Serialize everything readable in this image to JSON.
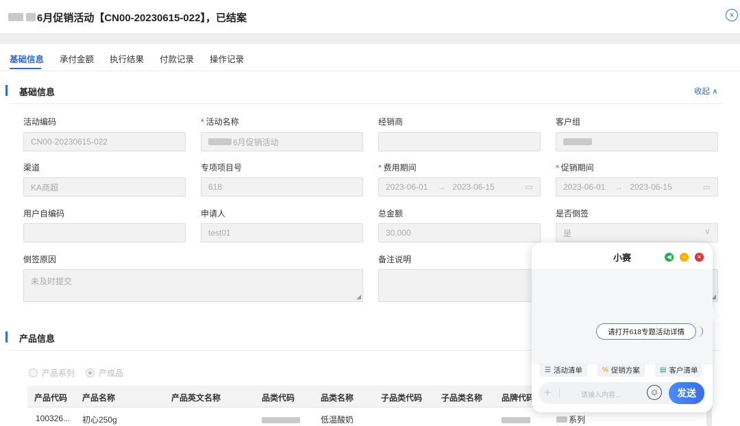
{
  "header": {
    "title": "6月促销活动【CN00-20230615-022】，已结案"
  },
  "tabs": [
    "基础信息",
    "承付金额",
    "执行结果",
    "付款记录",
    "操作记录"
  ],
  "sections": {
    "basic": {
      "title": "基础信息",
      "collapse": "收起 ∧"
    },
    "product": {
      "title": "产品信息"
    }
  },
  "fields": {
    "activity_code": {
      "label": "活动编码",
      "value": "CN00-20230615-022"
    },
    "activity_name": {
      "label": "活动名称",
      "value": "6月促销活动"
    },
    "dealer": {
      "label": "经销商",
      "value": ""
    },
    "customer_group": {
      "label": "客户组",
      "value": ""
    },
    "channel": {
      "label": "渠道",
      "value": "KA商超"
    },
    "project_no": {
      "label": "专项项目号",
      "value": "618"
    },
    "expense_period": {
      "label": "费用期间",
      "start": "2023-06-01",
      "end": "2023-06-15"
    },
    "promo_period": {
      "label": "促销期间",
      "start": "2023-06-01",
      "end": "2023-06-15"
    },
    "user_code": {
      "label": "用户自编码",
      "value": ""
    },
    "applicant": {
      "label": "申请人",
      "value": "test01"
    },
    "total_amount": {
      "label": "总金额",
      "value": "30,000"
    },
    "backdated": {
      "label": "是否倒签",
      "value": "是"
    },
    "backdate_reason": {
      "label": "倒签原因",
      "value": "未及时提交"
    },
    "remarks": {
      "label": "备注说明",
      "value": ""
    }
  },
  "radio": {
    "option1": "产品系列",
    "option2": "产成品"
  },
  "table": {
    "headers": [
      "产品代码",
      "产品名称",
      "产品英文名称",
      "品类代码",
      "品类名称",
      "子品类代码",
      "子品类名称",
      "品牌代码"
    ],
    "rows": [
      {
        "code": "100326...",
        "name": "初心250g",
        "category_name": "低温酸奶",
        "brand_series": "系列"
      }
    ]
  },
  "chat": {
    "title": "小赛",
    "message": "请打开618专题活动详情",
    "quick_actions": [
      "活动清单",
      "促销方案",
      "客户清单"
    ],
    "placeholder": "请输入内容...",
    "send_label": "发送"
  },
  "colors": {
    "accent": "#2f6bd8",
    "required": "#e0343b",
    "dot_green": "#22b14c",
    "dot_yellow": "#f4b400",
    "dot_red": "#e0343b"
  }
}
